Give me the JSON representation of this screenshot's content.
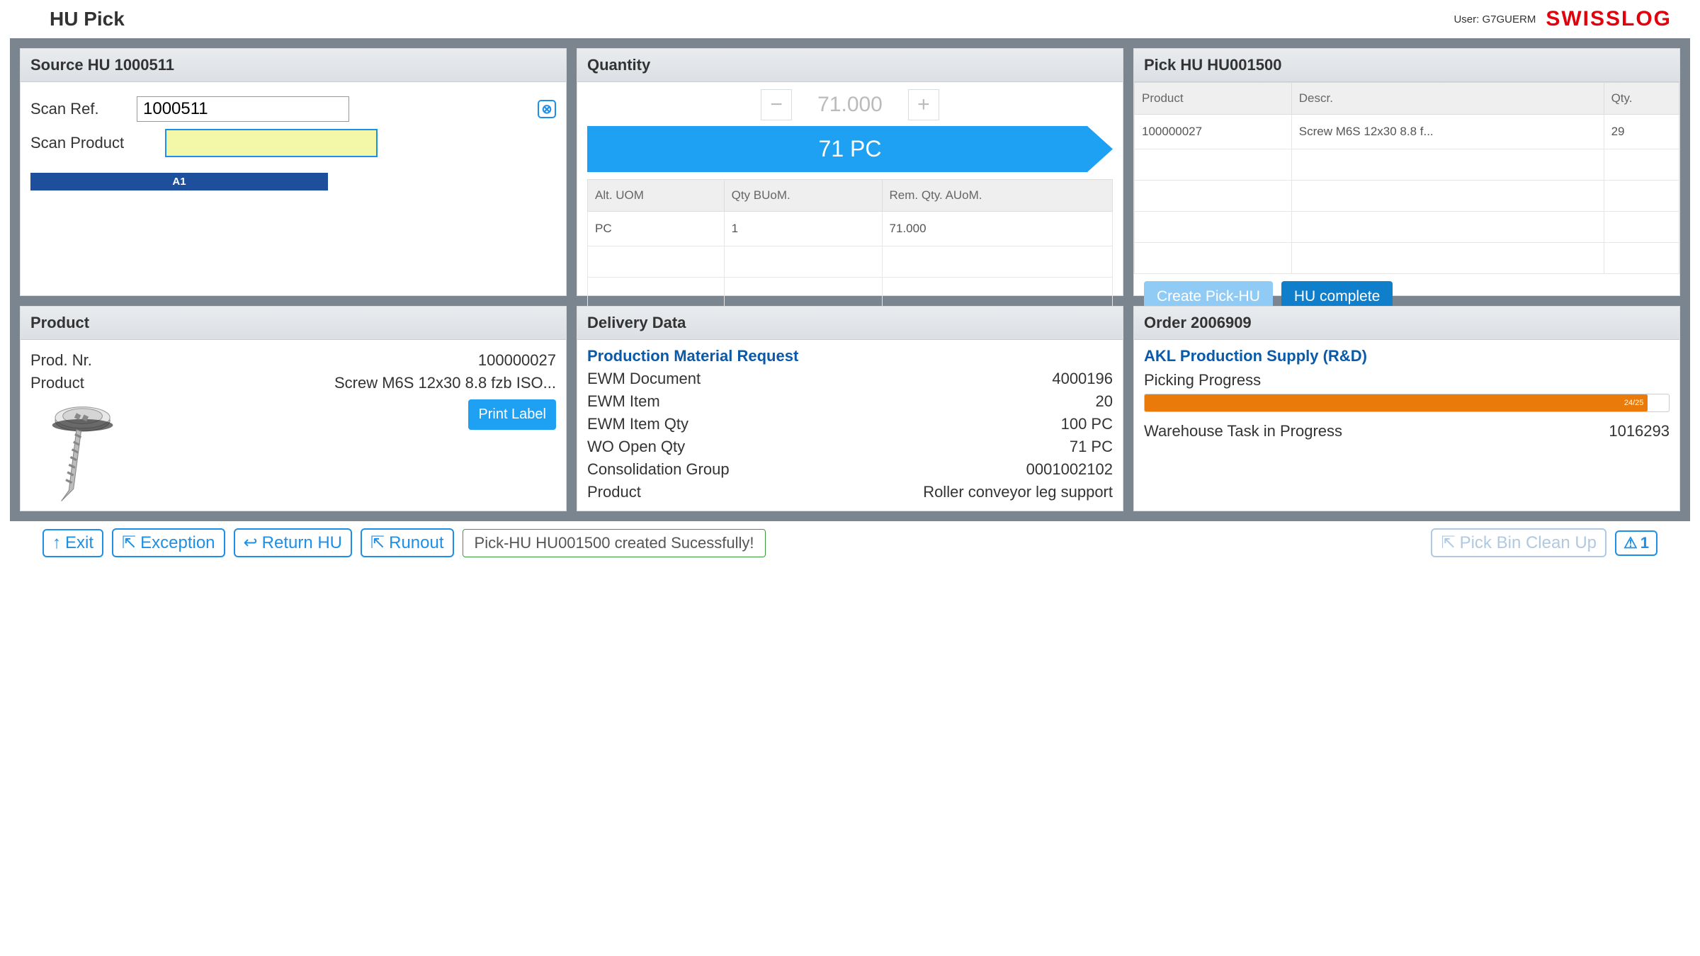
{
  "header": {
    "title": "HU Pick",
    "user_prefix": "User:",
    "user": "G7GUERM",
    "logo": "SWISSLOG"
  },
  "sourceHu": {
    "title": "Source HU 1000511",
    "scan_ref_label": "Scan Ref.",
    "scan_ref_value": "1000511",
    "scan_product_label": "Scan Product",
    "scan_product_value": "",
    "bin": "A1"
  },
  "quantity": {
    "title": "Quantity",
    "stepper_value": "71.000",
    "arrow_text": "71 PC",
    "columns": {
      "alt_uom": "Alt. UOM",
      "qty_buom": "Qty BUoM.",
      "rem_qty": "Rem. Qty. AUoM."
    },
    "rows": [
      {
        "alt_uom": "PC",
        "qty_buom": "1",
        "rem_qty": "71.000"
      }
    ]
  },
  "pickHu": {
    "title": "Pick HU HU001500",
    "columns": {
      "product": "Product",
      "descr": "Descr.",
      "qty": "Qty."
    },
    "rows": [
      {
        "product": "100000027",
        "descr": "Screw M6S 12x30 8.8 f...",
        "qty": "29"
      }
    ],
    "create_btn": "Create Pick-HU",
    "complete_btn": "HU complete"
  },
  "product": {
    "title": "Product",
    "prod_nr_label": "Prod. Nr.",
    "prod_nr_value": "100000027",
    "product_label": "Product",
    "product_value": "Screw M6S 12x30 8.8 fzb ISO...",
    "print_label": "Print Label"
  },
  "delivery": {
    "title": "Delivery Data",
    "heading": "Production Material Request",
    "rows": [
      {
        "label": "EWM Document",
        "value": "4000196"
      },
      {
        "label": "EWM Item",
        "value": "20"
      },
      {
        "label": "EWM Item Qty",
        "value": "100 PC"
      },
      {
        "label": "WO Open Qty",
        "value": "71 PC"
      },
      {
        "label": "Consolidation Group",
        "value": "0001002102"
      },
      {
        "label": "Product",
        "value": "Roller conveyor leg support"
      }
    ]
  },
  "order": {
    "title": "Order 2006909",
    "heading": "AKL Production Supply (R&D)",
    "progress_label": "Picking Progress",
    "progress_text": "24/25",
    "wt_label": "Warehouse Task in Progress",
    "wt_value": "1016293"
  },
  "footer": {
    "exit": "Exit",
    "exception": "Exception",
    "return_hu": "Return HU",
    "runout": "Runout",
    "status": "Pick-HU HU001500 created Sucessfully!",
    "cleanup": "Pick Bin Clean Up",
    "alert_count": "1"
  }
}
